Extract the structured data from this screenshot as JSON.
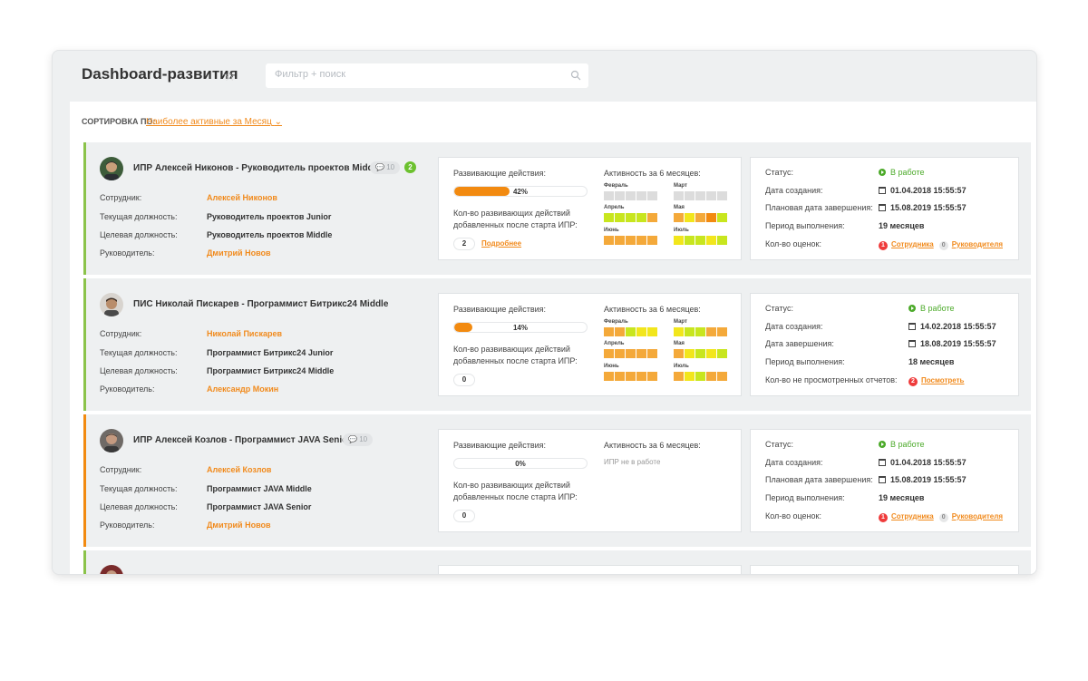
{
  "header": {
    "title": "Dashboard-развития",
    "search_placeholder": "Фильтр + поиск"
  },
  "sort": {
    "label": "Сортировка по:",
    "value": "Наиболее активные за Месяц"
  },
  "colors": {
    "accent": "#f18a1c",
    "green": "#6cc12f",
    "red": "#ef3b3b",
    "stripe_green": "#8bc34a",
    "stripe_orange": "#f28a10"
  },
  "labels": {
    "employee": "Сотрудник:",
    "current_position": "Текущая должность:",
    "target_position": "Целевая должность:",
    "manager": "Руководитель:",
    "dev_actions": "Развивающие действия:",
    "activity": "Активность за 6 месяцев:",
    "status": "Статус:",
    "created": "Дата создания:",
    "period": "Период выполнения:"
  },
  "cards": [
    {
      "title": "ИПР Алексей Никонов - Руководитель проектов Middle",
      "comments": "10",
      "badge": "2",
      "employee": "Алексей Никонов",
      "current_position": "Руководитель проектов Junior",
      "target_position": "Руководитель проектов Middle",
      "manager": "Дмитрий Новов",
      "progress": 42,
      "progress_label": "42%",
      "count_label": "Кол-во развивающих действий добавленных после старта ИПР:",
      "count": "2",
      "more": "Подробнее",
      "months": [
        "Февраль",
        "Март",
        "Апрель",
        "Мая",
        "Июнь",
        "Июль"
      ],
      "status": "В работе",
      "created": "01.04.2018 15:55:57",
      "due_label": "Плановая дата завершения:",
      "due": "15.08.2019 15:55:57",
      "period": "19 месяцев",
      "extra_label": "Кол-во оценок:",
      "extra_red": "1",
      "extra_red_link": "Сотрудника",
      "extra_grey": "0",
      "extra_grey_link": "Руководителя"
    },
    {
      "title": "ПИС Николай Пискарев - Программист Битрикс24 Middle",
      "employee": "Николай Пискарев",
      "current_position": "Программист Битрикс24 Junior",
      "target_position": "Программист Битрикс24 Middle",
      "manager": "Александр Мокин",
      "progress": 14,
      "progress_label": "14%",
      "count_label": "Кол-во развивающих действий добавленных после старта ИПР:",
      "count": "0",
      "months": [
        "Февраль",
        "Март",
        "Апрель",
        "Мая",
        "Июнь",
        "Июль"
      ],
      "status": "В работе",
      "created": "14.02.2018 15:55:57",
      "due_label": "Дата завершения:",
      "due": "18.08.2019 15:55:57",
      "period": "18 месяцев",
      "extra_label": "Кол-во не просмотренных отчетов:",
      "extra_red": "2",
      "extra_red_link": "Посмотреть"
    },
    {
      "title": "ИПР Алексей Козлов - Программист JAVA Senior",
      "comments": "10",
      "employee": "Алексей Козлов",
      "current_position": "Программист JAVA Middle",
      "target_position": "Программист JAVA Senior",
      "manager": "Дмитрий Новов",
      "progress": 0,
      "progress_label": "0%",
      "count_label": "Кол-во развивающих действий добавленных после старта ИПР:",
      "count": "0",
      "activity_none": "ИПР не в работе",
      "status": "В работе",
      "created": "01.04.2018 15:55:57",
      "due_label": "Плановая дата завершения:",
      "due": "15.08.2019 15:55:57",
      "period": "19 месяцев",
      "extra_label": "Кол-во оценок:",
      "extra_red": "1",
      "extra_red_link": "Сотрудника",
      "extra_grey": "0",
      "extra_grey_link": "Руководителя"
    }
  ]
}
